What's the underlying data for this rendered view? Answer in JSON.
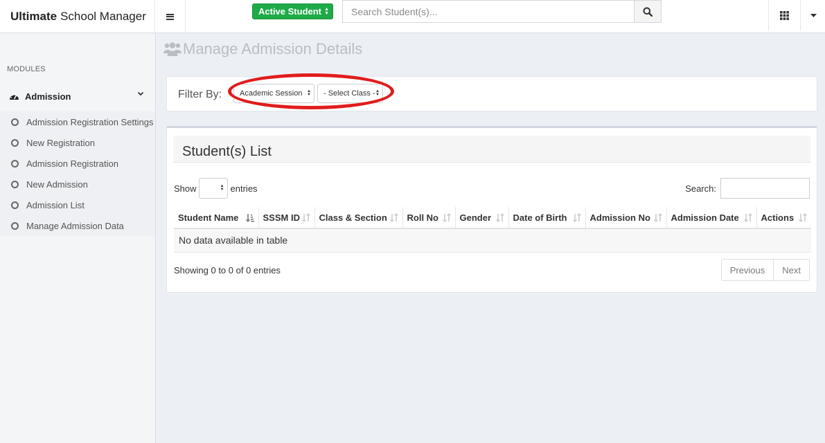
{
  "header": {
    "brand_bold": "Ultimate",
    "brand_rest": "School Manager",
    "status_select": "Active Student",
    "search_placeholder": "Search Student(s)..."
  },
  "sidebar": {
    "section_label": "MODULES",
    "menu": {
      "label": "Admission",
      "items": [
        {
          "label": "Admission Registration Settings"
        },
        {
          "label": "New Registration"
        },
        {
          "label": "Admission Registration"
        },
        {
          "label": "New Admission"
        },
        {
          "label": "Admission List"
        },
        {
          "label": "Manage Admission Data"
        }
      ]
    }
  },
  "main": {
    "page_title": "Manage Admission Details",
    "filter": {
      "label": "Filter By:",
      "session_select": "Academic Session",
      "class_select": "- Select Class -",
      "highlight_color": "#e11c1c"
    },
    "list": {
      "title": "Student(s) List",
      "show_label": "Show",
      "entries_label": "entries",
      "search_label": "Search:",
      "columns": [
        "Student Name",
        "SSSM ID",
        "Class & Section",
        "Roll No",
        "Gender",
        "Date of Birth",
        "Admission No",
        "Admission Date",
        "Actions"
      ],
      "empty_message": "No data available in table",
      "info": "Showing 0 to 0 of 0 entries",
      "prev_label": "Previous",
      "next_label": "Next"
    }
  },
  "colors": {
    "accent_green": "#1faa48",
    "background": "#ecf0f5"
  }
}
